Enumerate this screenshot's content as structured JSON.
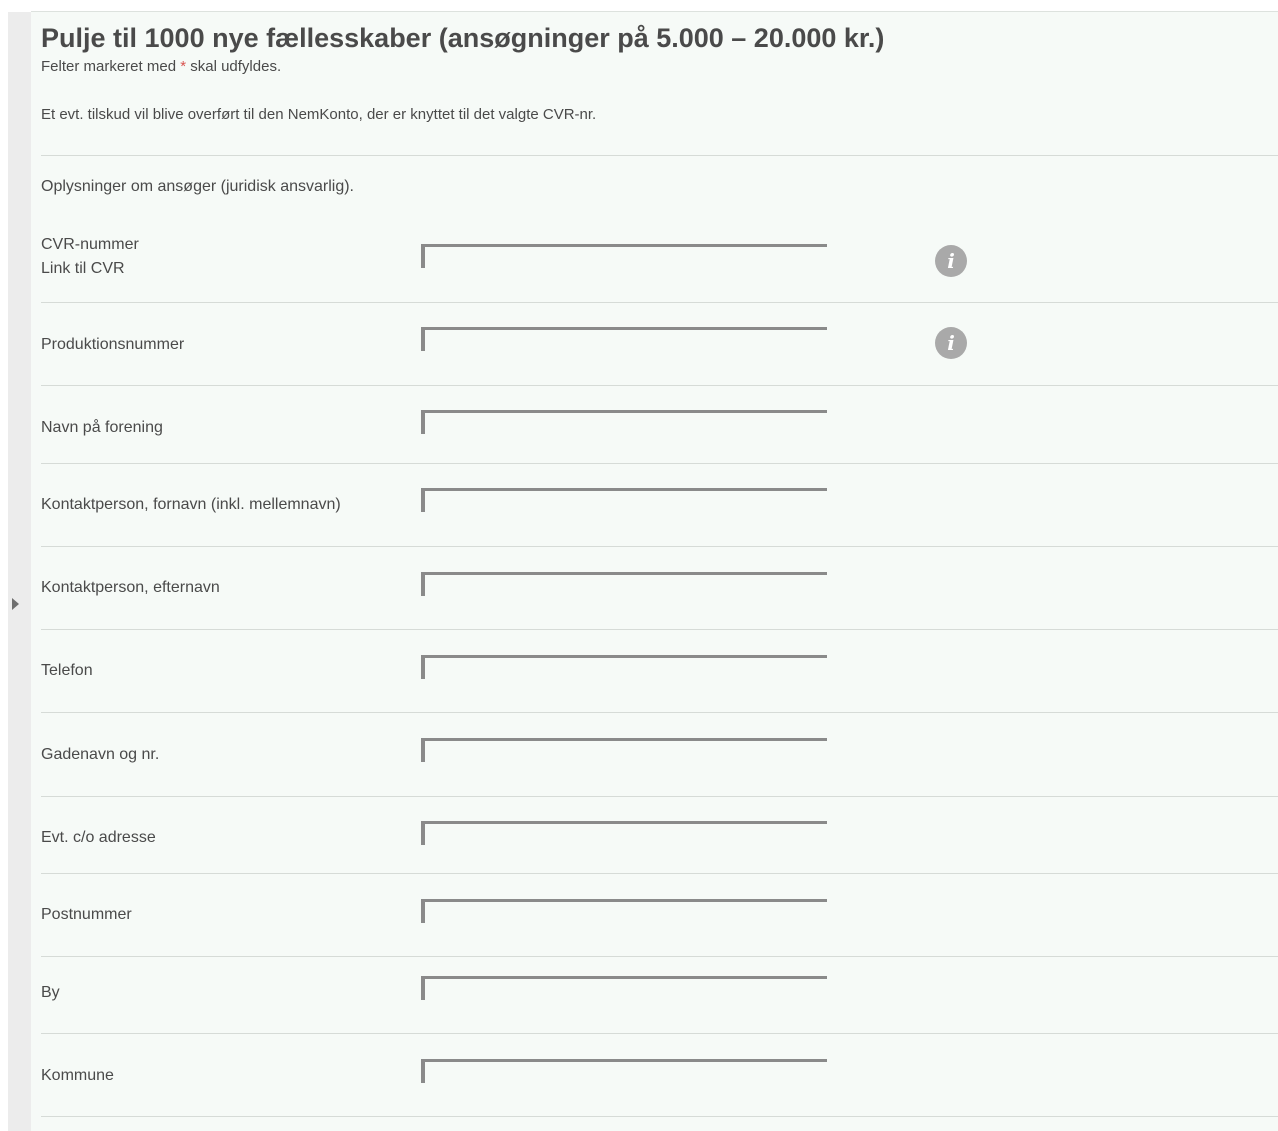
{
  "form": {
    "title": "Pulje til 1000 nye fællesskaber (ansøgninger på 5.000 – 20.000 kr.)",
    "required_note_before": "Felter markeret med ",
    "required_marker": "*",
    "required_note_after": " skal udfyldes.",
    "intro": "Et evt. tilskud vil blive overført til den NemKonto, der er knyttet til det valgte CVR-nr.",
    "section_label": "Oplysninger om ansøger (juridisk ansvarlig).",
    "info_icon_glyph": "i",
    "fields": [
      {
        "label": "CVR-nummer",
        "sublabel": "Link til CVR",
        "value": "",
        "has_info": true
      },
      {
        "label": "Produktionsnummer",
        "value": "",
        "has_info": true
      },
      {
        "label": "Navn på forening",
        "value": ""
      },
      {
        "label": "Kontaktperson, fornavn (inkl. mellemnavn)",
        "value": ""
      },
      {
        "label": "Kontaktperson, efternavn",
        "value": ""
      },
      {
        "label": "Telefon",
        "value": ""
      },
      {
        "label": "Gadenavn og nr.",
        "value": ""
      },
      {
        "label": "Evt. c/o adresse",
        "value": ""
      },
      {
        "label": "Postnummer",
        "value": ""
      },
      {
        "label": "By",
        "value": ""
      },
      {
        "label": "Kommune",
        "value": ""
      }
    ]
  },
  "icons": {
    "info": "info-icon",
    "toggle": "caret-right-icon"
  },
  "colors": {
    "panel_background": "#f6faf7",
    "text": "#4a4a4a",
    "input_border": "#8a8a8a",
    "info_icon": "#a9a9a9",
    "required_star": "#d9534f"
  }
}
